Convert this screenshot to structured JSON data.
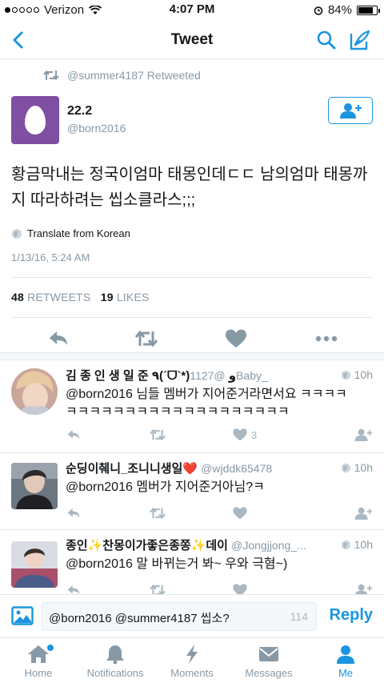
{
  "status_bar": {
    "carrier": "Verizon",
    "time": "4:07 PM",
    "battery": "84%",
    "battery_level": 0.84
  },
  "nav": {
    "title": "Tweet"
  },
  "tweet": {
    "retweeted_by": "@summer4187 Retweeted",
    "author_name": "22.2",
    "author_handle": "@born2016",
    "text": "황금막내는 정국이엄마 태몽인데ㄷㄷ 남의엄마 태몽까지 따라하려는 씹소클라스;;;",
    "translate": "Translate from Korean",
    "timestamp": "1/13/16, 5:24 AM",
    "retweets_count": "48",
    "retweets_label": "RETWEETS",
    "likes_count": "19",
    "likes_label": "LIKES"
  },
  "replies": [
    {
      "name": "김 종 인 생 일 준 ٩(´ᗜ`*)و",
      "handle": "@1127Baby_",
      "age": "10h",
      "text": "@born2016 님들 멤버가 지어준거라면서요 ㅋㅋㅋㅋ ㅋㅋㅋㅋㅋㅋㅋㅋㅋㅋㅋㅋㅋㅋㅋㅋㅋㅋㅋ",
      "likes": "3"
    },
    {
      "name": "순딩이췌니_조니니생일❤️",
      "handle": "@wjddk65478",
      "age": "10h",
      "text": "@born2016 멤버가 지어준거아님?ㅋ",
      "likes": ""
    },
    {
      "name": "종인✨찬몽이가좋은종쫑✨데이",
      "handle": "@Jongjjong_...",
      "age": "10h",
      "text": "@born2016 말 바뀌는거 봐~ 우와 극혐~)",
      "likes": ""
    }
  ],
  "composer": {
    "value": "@born2016 @summer4187 씹소?",
    "remaining": "114",
    "reply_label": "Reply"
  },
  "tabs": [
    {
      "label": "Home",
      "icon": "home-icon"
    },
    {
      "label": "Notifications",
      "icon": "bell-icon"
    },
    {
      "label": "Moments",
      "icon": "lightning-icon"
    },
    {
      "label": "Messages",
      "icon": "envelope-icon"
    },
    {
      "label": "Me",
      "icon": "person-icon"
    }
  ],
  "colors": {
    "accent": "#1b95e0",
    "muted": "#8899a6",
    "like_heart": "#e0245e",
    "avatar_bg": "#7f4fa3"
  }
}
